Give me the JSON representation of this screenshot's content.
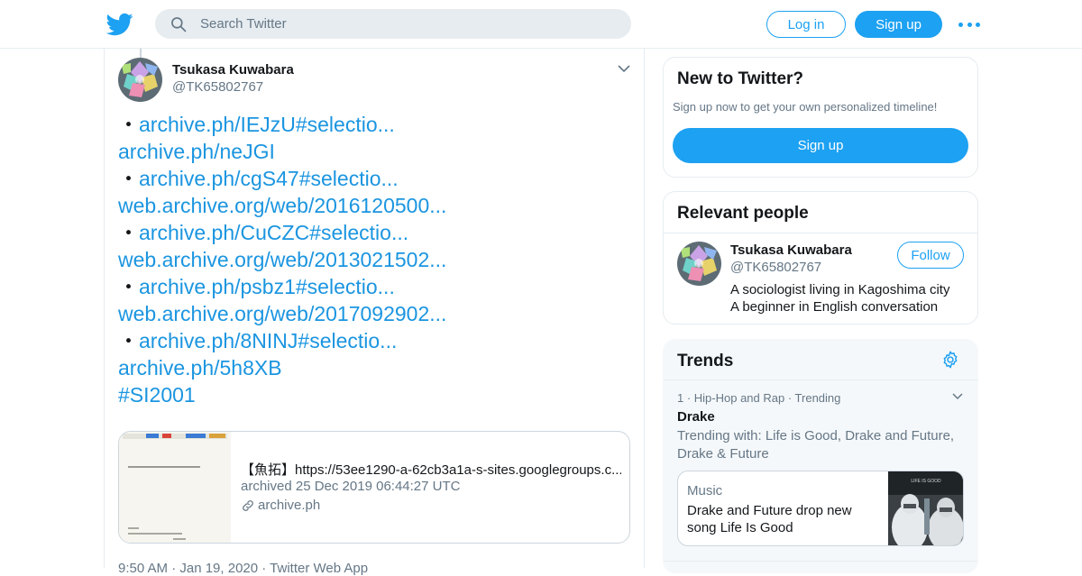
{
  "header": {
    "search_placeholder": "Search Twitter",
    "login_label": "Log in",
    "signup_label": "Sign up"
  },
  "tweet": {
    "author_name": "Tsukasa Kuwabara",
    "author_handle": "@TK65802767",
    "lines": [
      {
        "prefix": "・",
        "link": "archive.ph/IEJzU#selectio..."
      },
      {
        "prefix": "",
        "link": "archive.ph/neJGI"
      },
      {
        "prefix": "・",
        "link": "archive.ph/cgS47#selectio..."
      },
      {
        "prefix": "",
        "link": "web.archive.org/web/2016120500..."
      },
      {
        "prefix": "・",
        "link": "archive.ph/CuCZC#selectio..."
      },
      {
        "prefix": "",
        "link": "web.archive.org/web/2013021502..."
      },
      {
        "prefix": "・",
        "link": "archive.ph/psbz1#selectio..."
      },
      {
        "prefix": "",
        "link": "web.archive.org/web/2017092902..."
      },
      {
        "prefix": "・",
        "link": "archive.ph/8NINJ#selectio..."
      },
      {
        "prefix": "",
        "link": "archive.ph/5h8XB"
      },
      {
        "prefix": "",
        "link": "#SI2001"
      }
    ],
    "card": {
      "title": "【魚拓】https://53ee1290-a-62cb3a1a-s-sites.googlegroups.c...",
      "description": "archived 25 Dec 2019 06:44:27 UTC",
      "domain": "archive.ph"
    },
    "meta": "9:50 AM · Jan 19, 2020 · Twitter Web App"
  },
  "sidebar": {
    "new_to_twitter": {
      "title": "New to Twitter?",
      "subtitle": "Sign up now to get your own personalized timeline!",
      "signup_label": "Sign up"
    },
    "relevant_people": {
      "title": "Relevant people",
      "person": {
        "name": "Tsukasa Kuwabara",
        "handle": "@TK65802767",
        "follow_label": "Follow",
        "bio_line1": "A sociologist living in Kagoshima city",
        "bio_line2": "A beginner in English conversation"
      }
    },
    "trends": {
      "title": "Trends",
      "item": {
        "meta": "1 · Hip-Hop and Rap · Trending",
        "name": "Drake",
        "trending_with": "Trending with: Life is Good, Drake and Future, Drake & Future",
        "card_category": "Music",
        "card_title": "Drake and Future drop new song Life Is Good",
        "card_image_text": "LIFE IS GOOD"
      }
    }
  },
  "colors": {
    "accent": "#1da1f2",
    "link": "#1b95e0",
    "secondary_text": "#657786",
    "border": "#e6ecf0"
  },
  "icons": [
    "twitter-bird-icon",
    "search-icon",
    "more-icon",
    "chevron-down-icon",
    "link-icon",
    "gear-icon"
  ]
}
